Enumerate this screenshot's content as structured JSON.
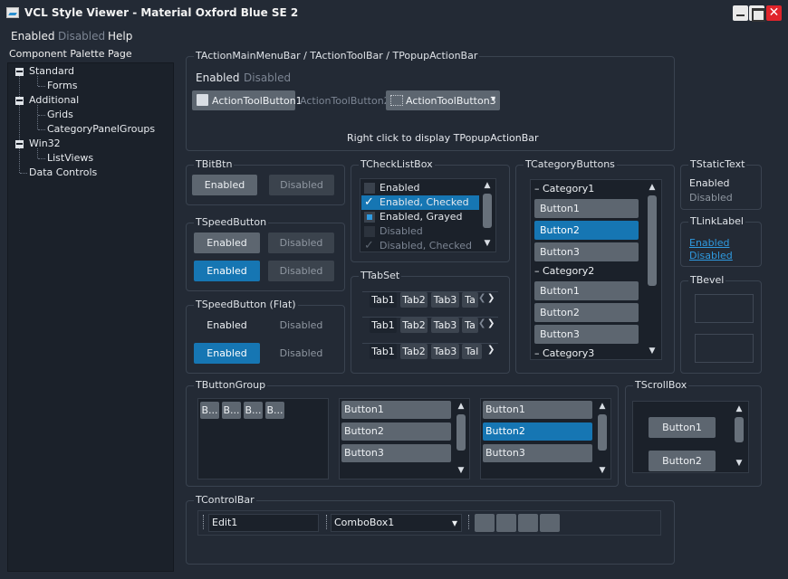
{
  "window": {
    "title": "VCL Style Viewer - Material Oxford Blue SE 2",
    "close_glyph": "✕"
  },
  "menu": {
    "items": [
      {
        "label": "Enabled"
      },
      {
        "label": "Disabled"
      },
      {
        "label": "Help"
      }
    ]
  },
  "palette": {
    "label": "Component Palette Page",
    "tree": [
      {
        "label": "Standard"
      },
      {
        "label": "Forms"
      },
      {
        "label": "Additional"
      },
      {
        "label": "Grids"
      },
      {
        "label": "CategoryPanelGroups"
      },
      {
        "label": "Win32"
      },
      {
        "label": "ListViews"
      },
      {
        "label": "Data Controls"
      }
    ]
  },
  "action_bars": {
    "caption": "TActionMainMenuBar / TActionToolBar / TPopupActionBar",
    "menu_enabled": "Enabled",
    "menu_disabled": "Disabled",
    "toolbutton1": "ActionToolButton1",
    "toolbutton2": "ActionToolButton2",
    "toolbutton3": "ActionToolButton3",
    "popup_hint": "Right click to display TPopupActionBar"
  },
  "bitbtn": {
    "caption": "TBitBtn",
    "enabled": "Enabled",
    "disabled": "Disabled"
  },
  "speedbutton": {
    "caption": "TSpeedButton",
    "enabled": "Enabled",
    "disabled": "Disabled"
  },
  "speedbutton_flat": {
    "caption": "TSpeedButton (Flat)",
    "enabled": "Enabled",
    "disabled": "Disabled"
  },
  "checklistbox": {
    "caption": "TCheckListBox",
    "items": [
      {
        "label": "Enabled"
      },
      {
        "label": "Enabled, Checked"
      },
      {
        "label": "Enabled, Grayed"
      },
      {
        "label": "Disabled"
      },
      {
        "label": "Disabled, Checked"
      }
    ]
  },
  "tabset": {
    "caption": "TTabSet",
    "tabs": [
      "Tab1",
      "Tab2",
      "Tab3",
      "Ta"
    ],
    "tabs2": [
      "Tab1",
      "Tab2",
      "Tab3",
      "Ta"
    ],
    "tabs3": [
      "Tab1",
      "Tab2",
      "Tab3",
      "Tal"
    ]
  },
  "categorybuttons": {
    "caption": "TCategoryButtons",
    "cat1": "Category1",
    "cat2": "Category2",
    "cat3": "Category3",
    "b1": "Button1",
    "b2": "Button2",
    "b3": "Button3"
  },
  "statictext": {
    "caption": "TStaticText",
    "enabled": "Enabled",
    "disabled": "Disabled"
  },
  "linklabel": {
    "caption": "TLinkLabel",
    "enabled": "Enabled",
    "disabled": "Disabled"
  },
  "bevel": {
    "caption": "TBevel"
  },
  "buttongroup": {
    "caption": "TButtonGroup",
    "short": "B...",
    "b1": "Button1",
    "b2": "Button2",
    "b3": "Button3"
  },
  "scrollbox": {
    "caption": "TScrollBox",
    "b1": "Button1",
    "b2": "Button2"
  },
  "controlbar": {
    "caption": "TControlBar",
    "edit": "Edit1",
    "combo": "ComboBox1"
  },
  "icons": {
    "arrow_up": "▲",
    "arrow_down": "▼",
    "arrow_left": "❮",
    "arrow_right": "❯",
    "dropdown": "▾",
    "check": "✓",
    "dash": "–"
  }
}
